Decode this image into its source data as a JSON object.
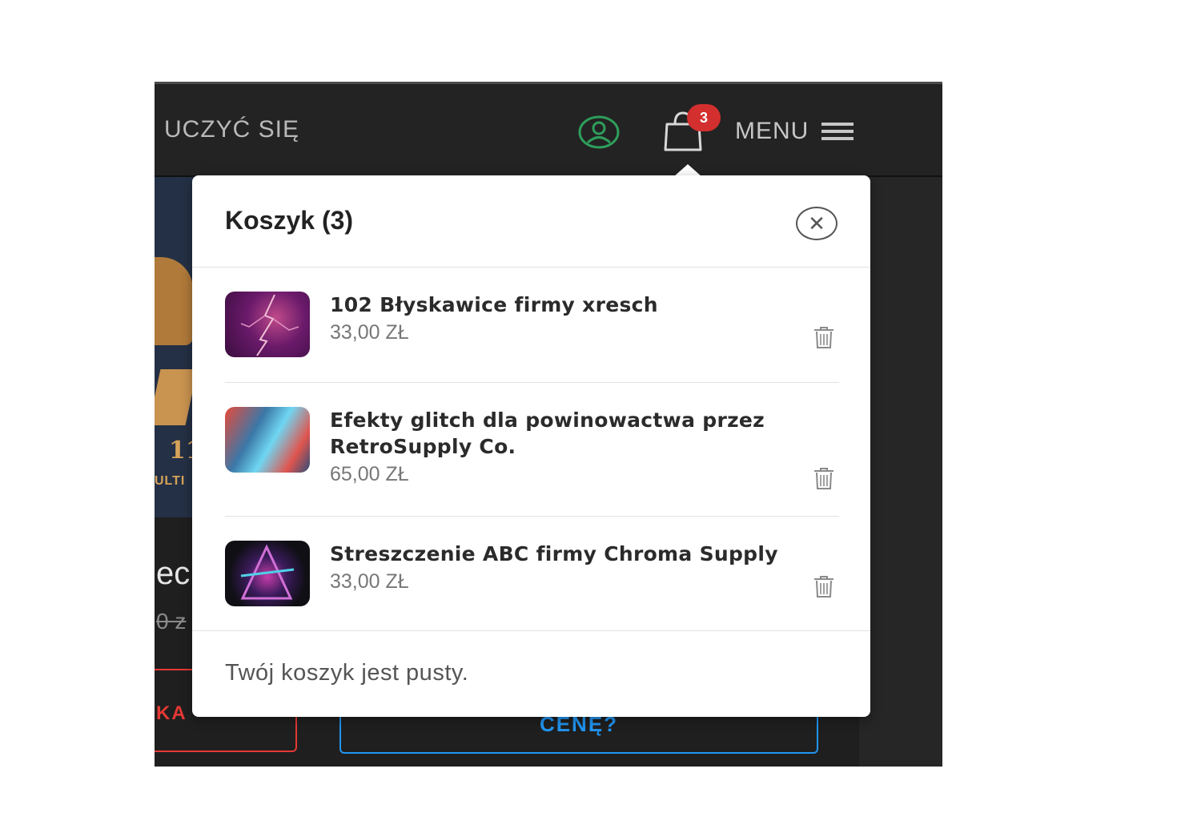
{
  "header": {
    "learn_label": "UCZYĆ SIĘ",
    "cart_count": "3",
    "menu_label": "MENU",
    "account_icon": "user-circle-icon",
    "cart_icon": "shopping-bag-icon",
    "menu_icon": "hamburger-icon"
  },
  "background": {
    "hero_number": "11",
    "hero_word": "ULTI",
    "title_fragment": "ec",
    "price_fragment": "0 z",
    "red_button_fragment": "KA",
    "blue_button_fragment": "CENĘ?"
  },
  "cart": {
    "title": "Koszyk (3)",
    "close_icon": "close-icon",
    "items": [
      {
        "name": "102 Błyskawice firmy xresch",
        "price": "33,00 ZŁ"
      },
      {
        "name": "Efekty glitch dla powinowactwa przez RetroSupply Co.",
        "price": "65,00 ZŁ"
      },
      {
        "name": "Streszczenie ABC firmy Chroma Supply",
        "price": "33,00 ZŁ"
      }
    ],
    "empty_message": "Twój koszyk jest pusty."
  },
  "colors": {
    "accent_green": "#2e9e5b",
    "badge_red": "#d32f2f",
    "button_blue": "#2196f3",
    "button_red": "#e53935"
  }
}
